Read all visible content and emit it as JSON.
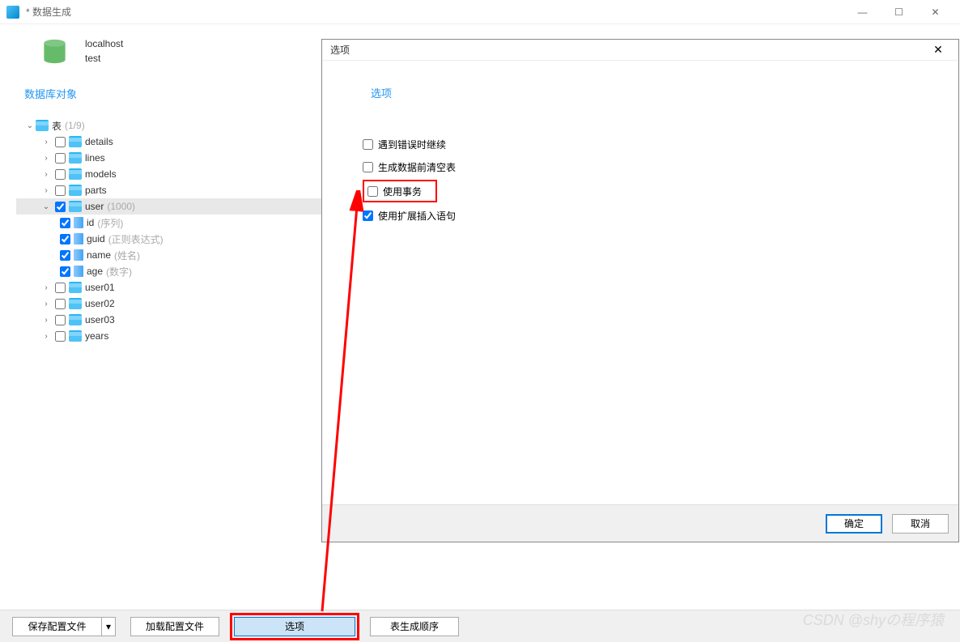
{
  "window": {
    "title": "* 数据生成",
    "minimize": "—",
    "maximize": "☐",
    "close": "✕"
  },
  "connection": {
    "host": "localhost",
    "database": "test"
  },
  "sidebar": {
    "header": "数据库对象",
    "root_label": "表",
    "root_count": "(1/9)",
    "tables": [
      {
        "name": "details",
        "checked": false,
        "selected": false,
        "expanded": false
      },
      {
        "name": "lines",
        "checked": false,
        "selected": false,
        "expanded": false
      },
      {
        "name": "models",
        "checked": false,
        "selected": false,
        "expanded": false
      },
      {
        "name": "parts",
        "checked": false,
        "selected": false,
        "expanded": false
      },
      {
        "name": "user",
        "checked": true,
        "selected": true,
        "expanded": true,
        "hint": "(1000)",
        "columns": [
          {
            "name": "id",
            "hint": "(序列)",
            "checked": true
          },
          {
            "name": "guid",
            "hint": "(正则表达式)",
            "checked": true
          },
          {
            "name": "name",
            "hint": "(姓名)",
            "checked": true
          },
          {
            "name": "age",
            "hint": "(数字)",
            "checked": true
          }
        ]
      },
      {
        "name": "user01",
        "checked": false,
        "selected": false,
        "expanded": false
      },
      {
        "name": "user02",
        "checked": false,
        "selected": false,
        "expanded": false
      },
      {
        "name": "user03",
        "checked": false,
        "selected": false,
        "expanded": false
      },
      {
        "name": "years",
        "checked": false,
        "selected": false,
        "expanded": false
      }
    ]
  },
  "bottom_bar": {
    "save_profile": "保存配置文件",
    "load_profile": "加载配置文件",
    "options": "选项",
    "gen_order": "表生成顺序"
  },
  "dialog": {
    "title": "选项",
    "close": "✕",
    "tab": "选项",
    "options": [
      {
        "label": "遇到错误时继续",
        "checked": false,
        "highlighted": false
      },
      {
        "label": "生成数据前清空表",
        "checked": false,
        "highlighted": false
      },
      {
        "label": "使用事务",
        "checked": false,
        "highlighted": true
      },
      {
        "label": "使用扩展插入语句",
        "checked": true,
        "highlighted": false
      }
    ],
    "ok": "确定",
    "cancel": "取消"
  },
  "watermark": "CSDN @shyの程序猿"
}
